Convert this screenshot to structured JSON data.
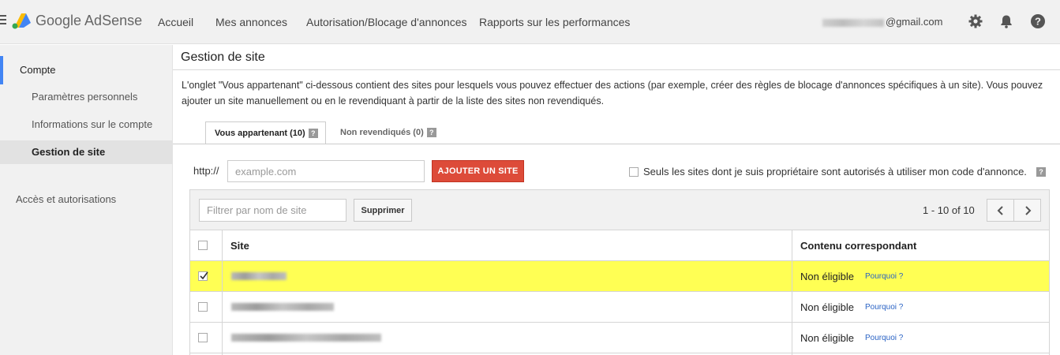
{
  "header": {
    "brand": "Google AdSense",
    "nav": [
      "Accueil",
      "Mes annonces",
      "Autorisation/Blocage d'annonces",
      "Rapports sur les performances"
    ],
    "account_suffix": "@gmail.com",
    "icons": [
      "gear-icon",
      "bell-icon",
      "help-icon"
    ]
  },
  "sidebar": {
    "section": "Compte",
    "items": [
      "Paramètres personnels",
      "Informations sur le compte",
      "Gestion de site"
    ],
    "active_item": "Gestion de site",
    "other": "Accès et autorisations"
  },
  "main": {
    "title": "Gestion de site",
    "description": "L'onglet \"Vous appartenant\" ci-dessous contient des sites pour lesquels vous pouvez effectuer des actions (par exemple, créer des règles de blocage d'annonces spécifiques à un site). Vous pouvez ajouter un site manuellement ou en le revendiquant à partir de la liste des sites non revendiqués.",
    "tabs": [
      {
        "label": "Vous appartenant (10)",
        "active": true
      },
      {
        "label": "Non revendiqués (0)",
        "active": false
      }
    ],
    "url_prefix": "http://",
    "url_placeholder": "example.com",
    "add_button": "AJOUTER UN SITE",
    "owner_checkbox_label": "Seuls les sites dont je suis propriétaire sont autorisés à utiliser mon code d'annonce."
  },
  "table": {
    "filter_placeholder": "Filtrer par nom de site",
    "delete_button": "Supprimer",
    "pager": "1 - 10 of 10",
    "columns": [
      "Site",
      "Contenu correspondant"
    ],
    "rows": [
      {
        "status": "Non éligible",
        "link": "Pourquoi ?",
        "selected": true
      },
      {
        "status": "Non éligible",
        "link": "Pourquoi ?",
        "selected": false
      },
      {
        "status": "Non éligible",
        "link": "Pourquoi ?",
        "selected": false
      }
    ]
  },
  "colors": {
    "accent": "#dd4b39",
    "selected_row": "#ffff54",
    "link": "#2962c4",
    "active_marker": "#4285f4"
  }
}
